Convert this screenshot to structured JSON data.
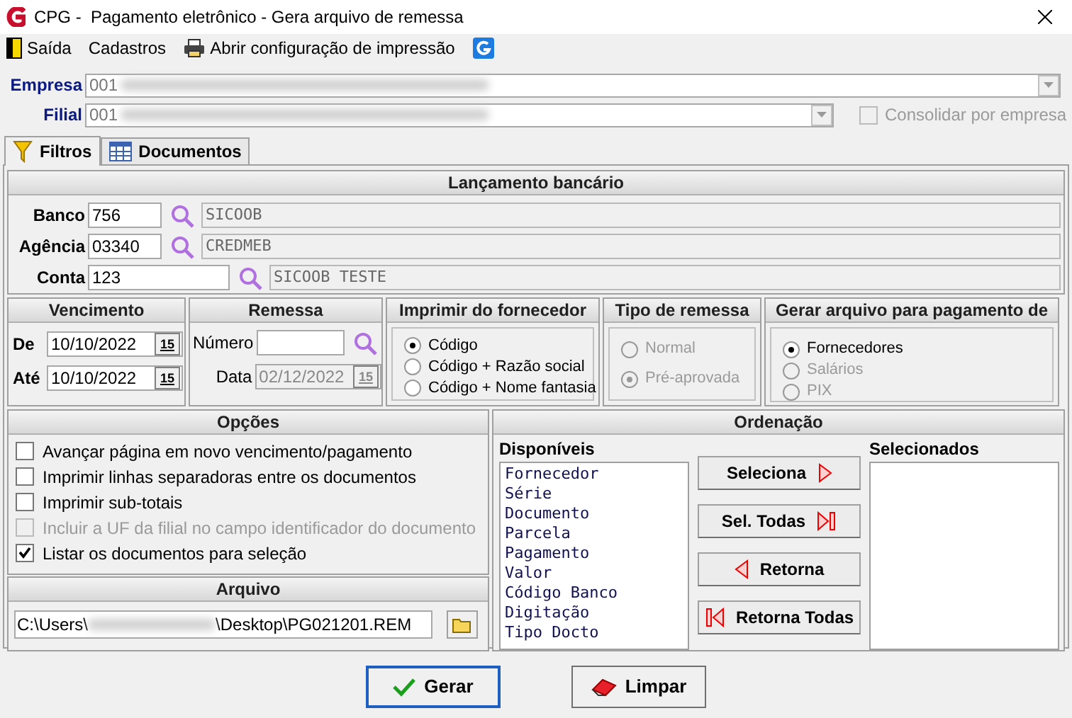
{
  "window": {
    "title": "CPG -  Pagamento eletrônico - Gera arquivo de remessa"
  },
  "menu": [
    {
      "label": "Saída"
    },
    {
      "label": "Cadastros"
    },
    {
      "label": "Abrir configuração de impressão"
    }
  ],
  "empresa": {
    "label": "Empresa",
    "code": "001"
  },
  "filial": {
    "label": "Filial",
    "code": "001"
  },
  "consolidar": {
    "label": "Consolidar por empresa",
    "checked": false,
    "disabled": true
  },
  "tabs": [
    {
      "label": "Filtros",
      "selected": true
    },
    {
      "label": "Documentos",
      "selected": false
    }
  ],
  "lancamento": {
    "title": "Lançamento bancário",
    "fields": [
      {
        "label": "Banco",
        "value": "756",
        "name": "SICOOB",
        "wide": false
      },
      {
        "label": "Agência",
        "value": "03340",
        "name": "CREDMEB",
        "wide": false
      },
      {
        "label": "Conta",
        "value": "123",
        "name": "SICOOB TESTE",
        "wide": true
      }
    ]
  },
  "vencimento": {
    "title": "Vencimento",
    "rows": [
      {
        "label": "De",
        "value": "10/10/2022",
        "button": "15"
      },
      {
        "label": "Até",
        "value": "10/10/2022",
        "button": "15"
      }
    ]
  },
  "remessa": {
    "title": "Remessa",
    "numero_label": "Número",
    "data_label": "Data",
    "data_value": "02/12/2022",
    "data_disabled": true,
    "button": "15"
  },
  "imprimir": {
    "title": "Imprimir do fornecedor",
    "options": [
      {
        "label": "Código",
        "selected": true,
        "disabled": false
      },
      {
        "label": "Código + Razão social",
        "selected": false,
        "disabled": false
      },
      {
        "label": "Código + Nome fantasia",
        "selected": false,
        "disabled": false
      }
    ]
  },
  "tipo": {
    "title": "Tipo de remessa",
    "options": [
      {
        "label": "Normal",
        "selected": false,
        "disabled": true
      },
      {
        "label": "Pré-aprovada",
        "selected": true,
        "disabled": true
      }
    ]
  },
  "gerar_arquivo": {
    "title": "Gerar arquivo para pagamento de",
    "options": [
      {
        "label": "Fornecedores",
        "selected": true,
        "disabled": false
      },
      {
        "label": "Salários",
        "selected": false,
        "disabled": true
      },
      {
        "label": "PIX",
        "selected": false,
        "disabled": true
      }
    ]
  },
  "opcoes": {
    "title": "Opções",
    "items": [
      {
        "label": "Avançar página em novo vencimento/pagamento",
        "checked": false,
        "disabled": false
      },
      {
        "label": "Imprimir linhas separadoras entre os documentos",
        "checked": false,
        "disabled": false
      },
      {
        "label": "Imprimir sub-totais",
        "checked": false,
        "disabled": false
      },
      {
        "label": "Incluir a UF da filial no campo identificador do documento",
        "checked": false,
        "disabled": true
      },
      {
        "label": "Listar os documentos para seleção",
        "checked": true,
        "disabled": false
      }
    ]
  },
  "arquivo": {
    "title": "Arquivo",
    "value_start": "C:\\Users\\",
    "value_end": "\\Desktop\\PG021201.REM"
  },
  "ordenacao": {
    "title": "Ordenação",
    "available_label": "Disponíveis",
    "selected_label": "Selecionados",
    "available": [
      "Fornecedor",
      "Série",
      "Documento",
      "Parcela",
      "Pagamento",
      "Valor",
      "Código Banco",
      "Digitação",
      "Tipo Docto"
    ],
    "buttons": [
      {
        "label": "Seleciona"
      },
      {
        "label": "Sel. Todas"
      },
      {
        "label": "Retorna"
      },
      {
        "label": "Retorna Todas"
      }
    ]
  },
  "actions": [
    {
      "label": "Gerar",
      "default": true
    },
    {
      "label": "Limpar",
      "default": false
    }
  ]
}
